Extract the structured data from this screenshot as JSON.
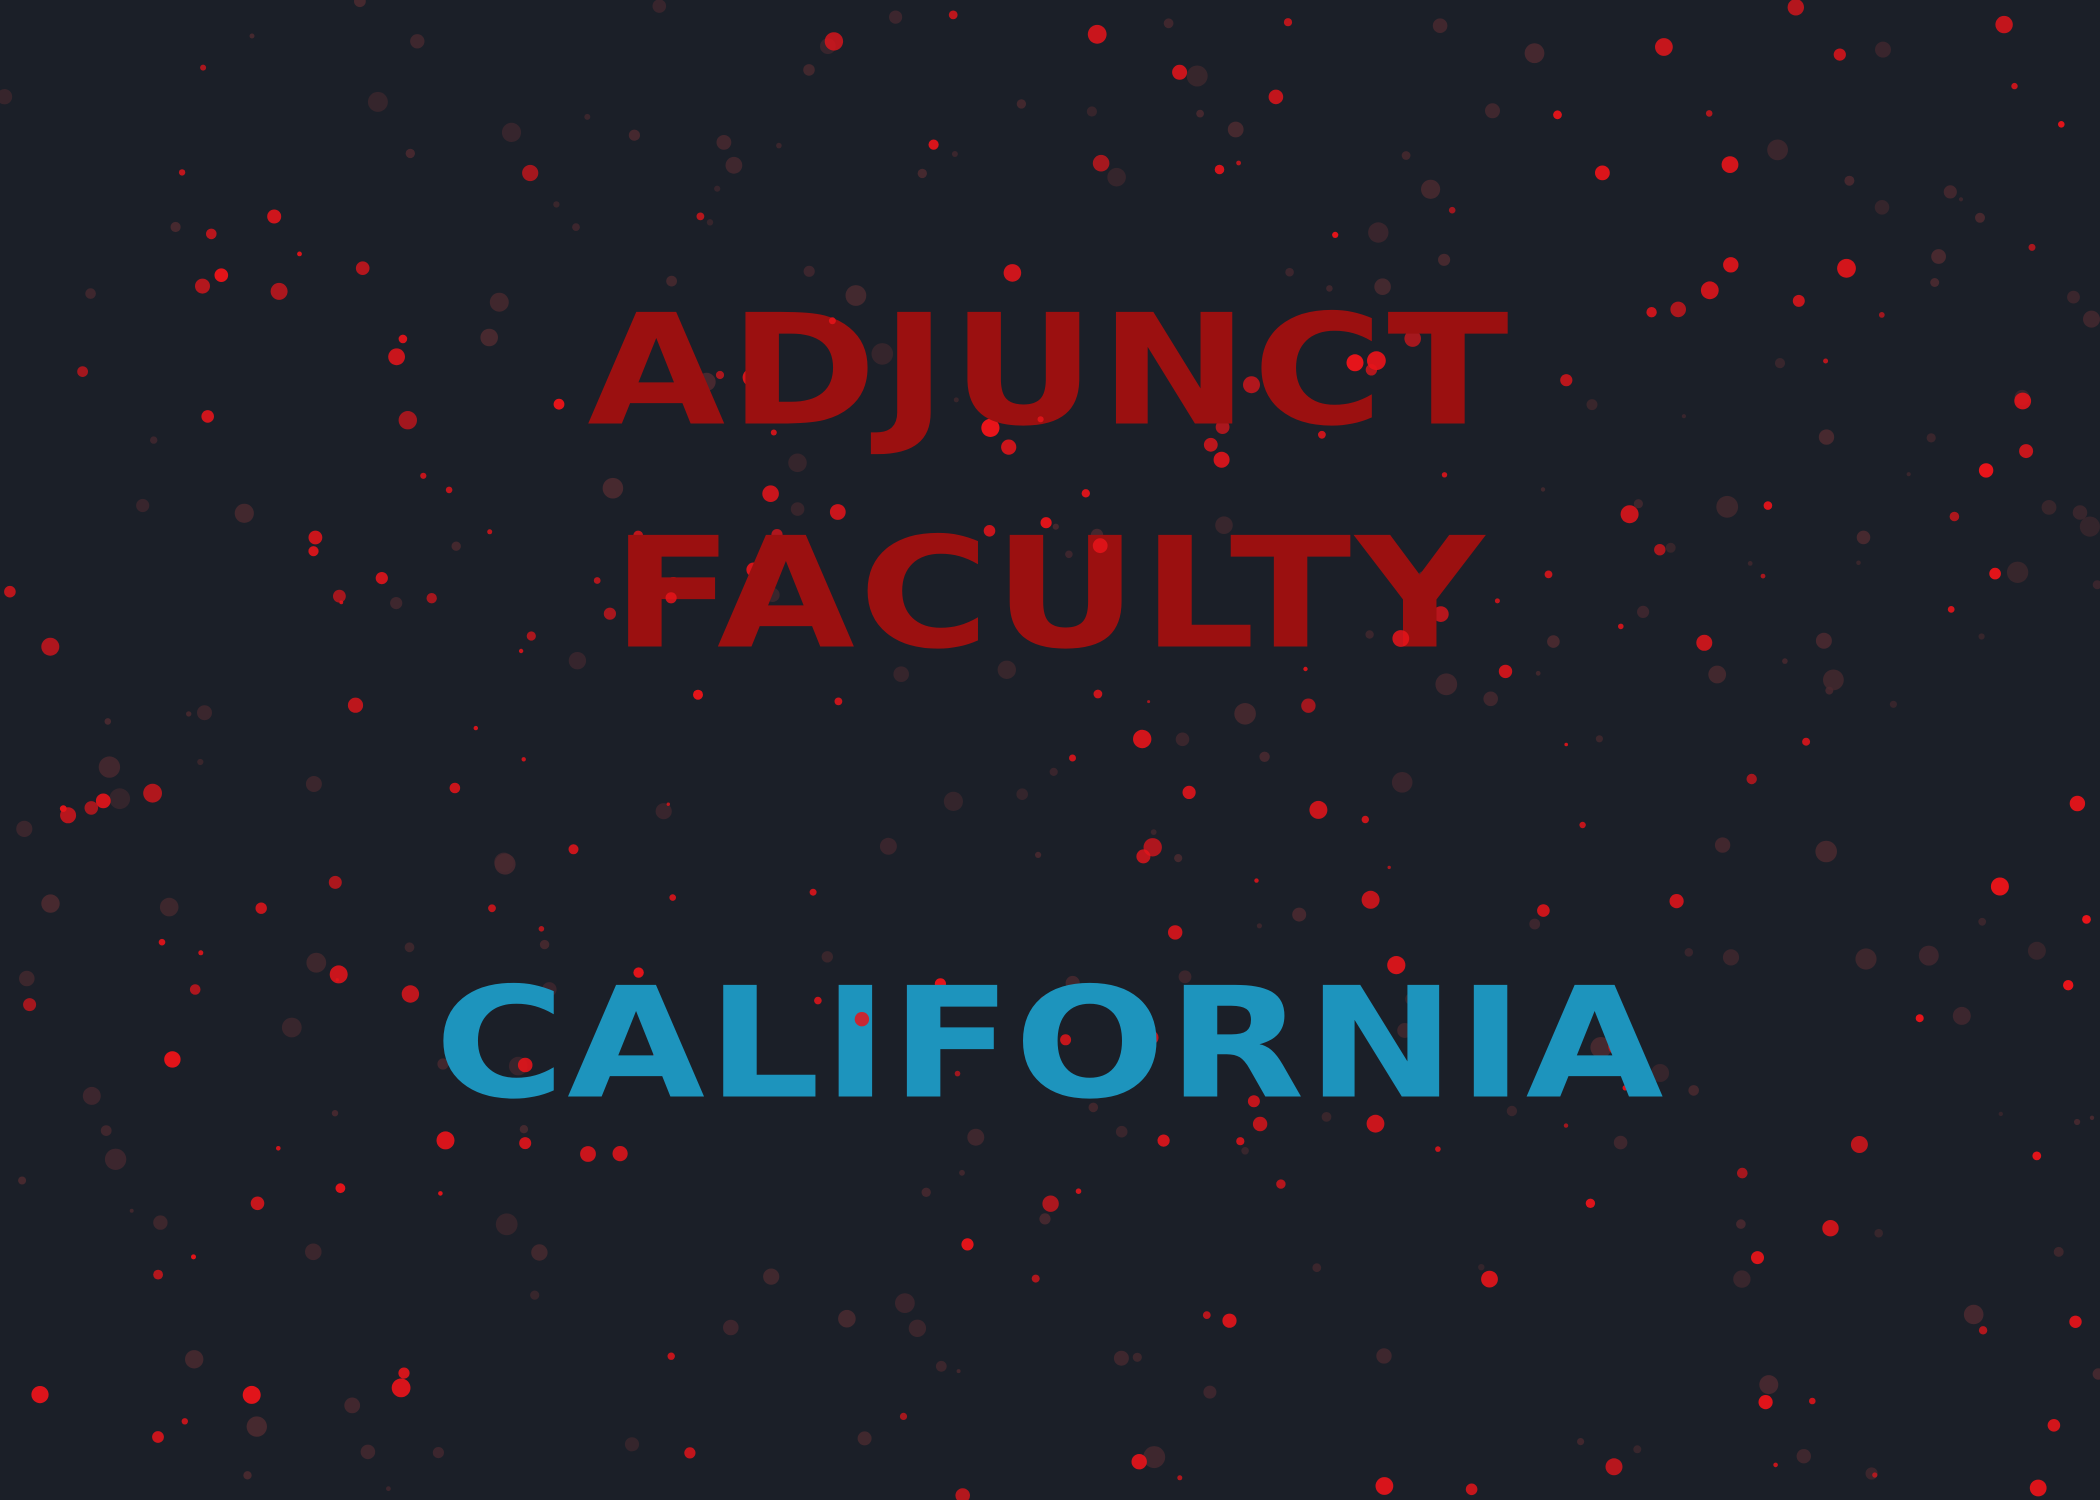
{
  "headline": {
    "line1": "ADJUNCT",
    "line2": "FACULTY",
    "line3": "CALIFORNIA"
  },
  "colors": {
    "background": "#1b1f28",
    "headline_red": "#9b1010",
    "headline_blue": "#1d94bd",
    "dot_bright": "#e8141a",
    "dot_dim": "#4a2a30"
  }
}
